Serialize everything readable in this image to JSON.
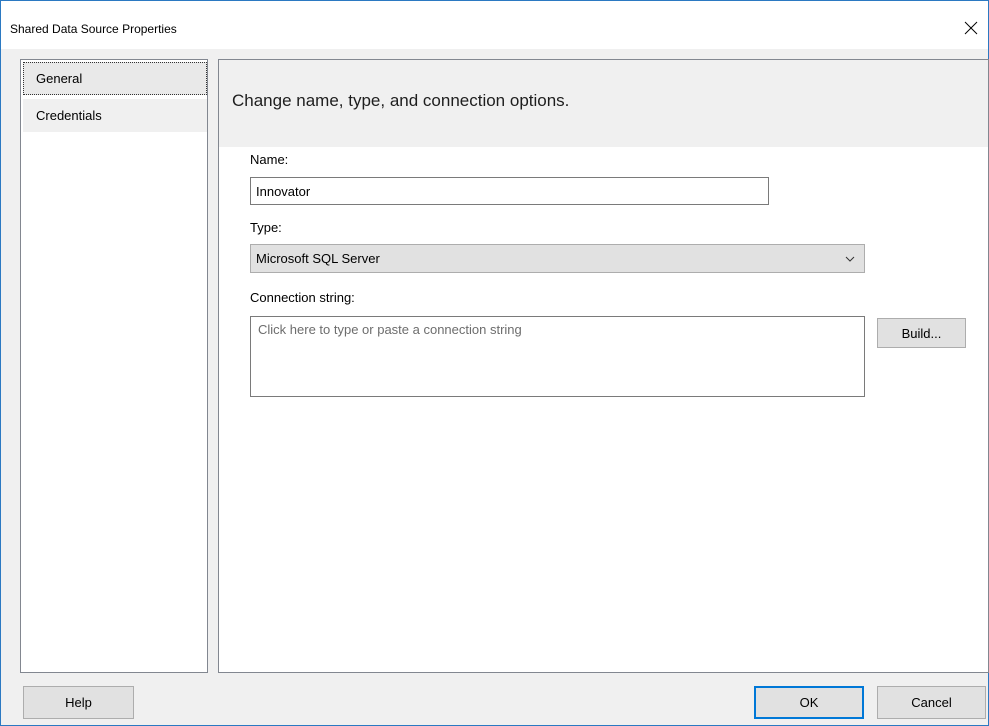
{
  "window": {
    "title": "Shared Data Source Properties",
    "close_icon": "close-icon"
  },
  "nav": {
    "items": [
      {
        "label": "General",
        "selected": true
      },
      {
        "label": "Credentials",
        "selected": false
      }
    ]
  },
  "content": {
    "header": "Change name, type, and connection options.",
    "name_label": "Name:",
    "name_value": "Innovator",
    "type_label": "Type:",
    "type_value": "Microsoft SQL Server",
    "type_dropdown_icon": "chevron-down-icon",
    "conn_label": "Connection string:",
    "conn_placeholder": "Click here to type or paste a connection string",
    "conn_value": "",
    "build_label": "Build..."
  },
  "footer": {
    "help_label": "Help",
    "ok_label": "OK",
    "cancel_label": "Cancel"
  },
  "colors": {
    "accent": "#0078d7",
    "window_border": "#2b79c2",
    "background": "#f0f0f0"
  }
}
